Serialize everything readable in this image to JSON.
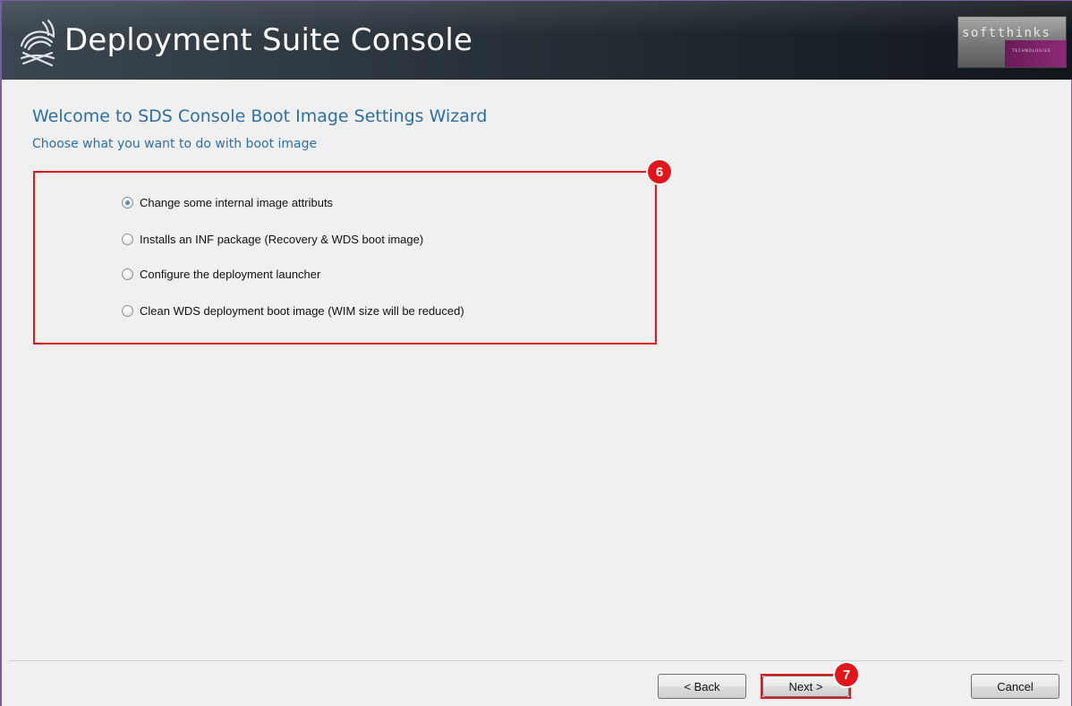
{
  "app": {
    "title": "Deployment Suite Console",
    "brand_text": "softthinks",
    "brand_sub": "TECHNOLOGIES"
  },
  "wizard": {
    "title": "Welcome to SDS Console Boot Image Settings Wizard",
    "subtitle": "Choose what you want to do with boot image"
  },
  "options": [
    {
      "label": "Change some internal image attributs",
      "selected": true
    },
    {
      "label": "Installs an INF package (Recovery & WDS boot image)",
      "selected": false
    },
    {
      "label": "Configure the deployment launcher",
      "selected": false
    },
    {
      "label": "Clean WDS deployment boot image (WIM size will be reduced)",
      "selected": false
    }
  ],
  "annotations": {
    "options_step": "6",
    "next_step": "7"
  },
  "buttons": {
    "back": "< Back",
    "next": "Next >",
    "cancel": "Cancel"
  },
  "colors": {
    "accent_blue": "#2c6fa6",
    "highlight_red": "#e3151a",
    "banner_dark": "#1f272e"
  }
}
